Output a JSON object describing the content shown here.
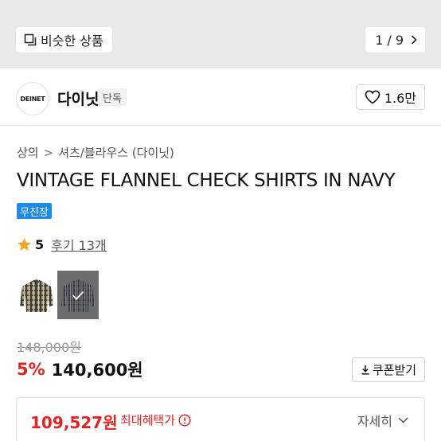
{
  "gallery": {
    "similar_label": "비슷한 상품",
    "page_current": "1",
    "page_sep": "/",
    "page_total": "9"
  },
  "brand": {
    "logo_text": "DEINET",
    "name": "다이닛",
    "tag": "단독",
    "likes": "1.6만"
  },
  "breadcrumb": {
    "items": [
      "상의",
      "셔츠/블라우스 (다이닛)"
    ],
    "separator": ">"
  },
  "product": {
    "title": "VINTAGE FLANNEL CHECK SHIRTS IN NAVY",
    "shipping_badge": "무진장",
    "rating": "5",
    "reviews": "후기 13개",
    "thumbnails": [
      {
        "icon": "shirt-beige-check-icon",
        "selected": false
      },
      {
        "icon": "shirt-navy-check-icon",
        "selected": true
      }
    ]
  },
  "price": {
    "original": "148,000원",
    "discount": "5%",
    "sale": "140,600원",
    "coupon_label": "쿠폰받기"
  },
  "benefit": {
    "price": "109,527원",
    "label": "최대혜택가",
    "detail_label": "자세히"
  },
  "colors": {
    "accent_red": "#e52222",
    "badge_blue": "#1a8cf0",
    "star": "#f5a623"
  }
}
